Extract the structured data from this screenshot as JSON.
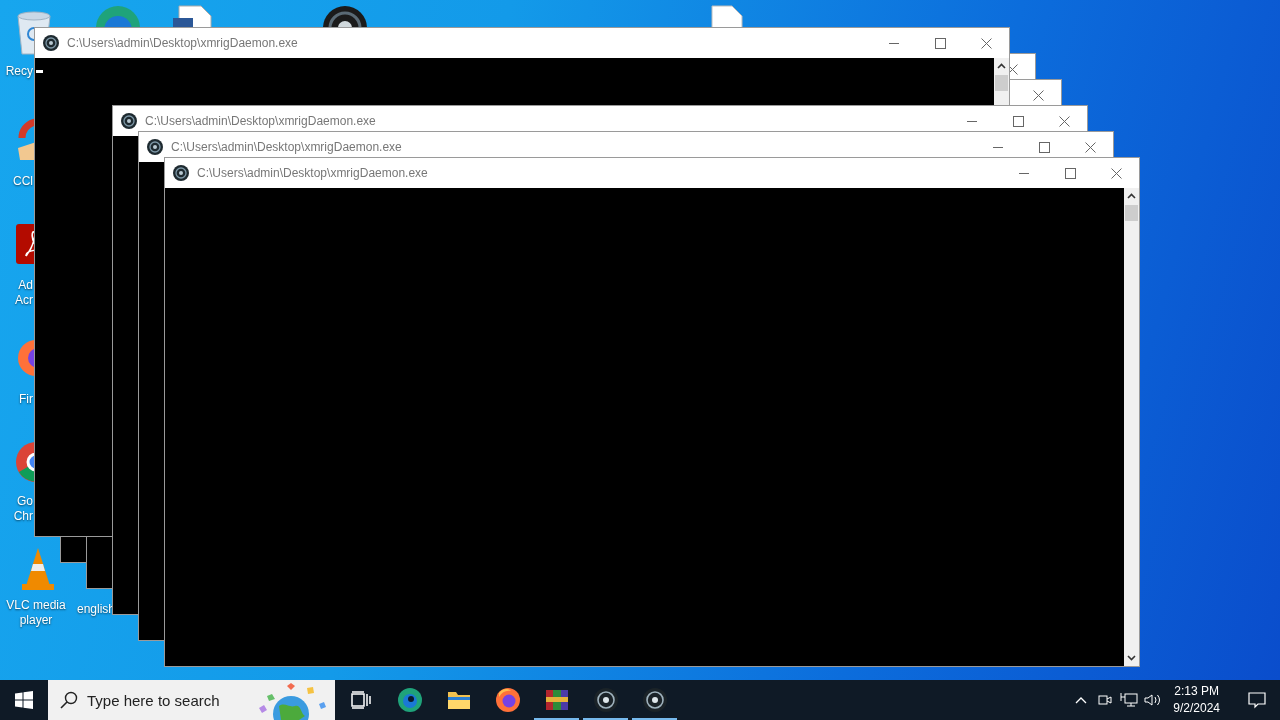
{
  "desktop": {
    "icons": [
      {
        "kind": "recycle",
        "lines": [
          "Recy"
        ]
      },
      {
        "kind": "ccleaner",
        "lines": [
          "CCl"
        ]
      },
      {
        "kind": "acrobat",
        "lines": [
          "Ad",
          "Acr"
        ]
      },
      {
        "kind": "firefox",
        "lines": [
          "Fir"
        ]
      },
      {
        "kind": "chrome",
        "lines": [
          "Go",
          "Chr"
        ]
      },
      {
        "kind": "vlc",
        "lines": [
          "VLC media",
          "player"
        ]
      },
      {
        "kind": "blank",
        "lines": [
          "english"
        ]
      },
      {
        "kind": "edge"
      },
      {
        "kind": "document"
      },
      {
        "kind": "miner"
      },
      {
        "kind": "file"
      }
    ]
  },
  "windows": [
    {
      "kind": "full",
      "title": "C:\\Users\\admin\\Desktop\\xmrigDaemon.exe"
    },
    {
      "kind": "peek"
    },
    {
      "kind": "strip"
    },
    {
      "kind": "titled",
      "title": "C:\\Users\\admin\\Desktop\\xmrigDaemon.exe"
    },
    {
      "kind": "titled",
      "title": "C:\\Users\\admin\\Desktop\\xmrigDaemon.exe"
    },
    {
      "kind": "full",
      "title": "C:\\Users\\admin\\Desktop\\xmrigDaemon.exe"
    }
  ],
  "taskbar": {
    "search": {
      "placeholder": "Type here to search"
    },
    "apps": [
      {
        "kind": "taskview",
        "running": false
      },
      {
        "kind": "edge",
        "running": false
      },
      {
        "kind": "folder",
        "running": false
      },
      {
        "kind": "firefox",
        "running": false
      },
      {
        "kind": "winrar",
        "running": true
      },
      {
        "kind": "miner",
        "running": true
      },
      {
        "kind": "miner",
        "running": true
      }
    ],
    "clock": {
      "time": "2:13 PM",
      "date": "9/2/2024"
    }
  }
}
